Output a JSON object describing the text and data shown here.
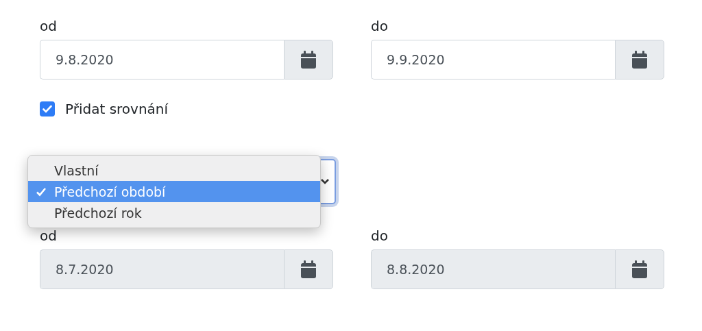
{
  "range": [
    {
      "label": "od",
      "value": "9.8.2020",
      "disabled": false
    },
    {
      "label": "do",
      "value": "9.9.2020",
      "disabled": false
    }
  ],
  "compare": {
    "label": "Přidat srovnání",
    "checked": true
  },
  "compare_select": {
    "options": [
      {
        "label": "Vlastní",
        "selected": false
      },
      {
        "label": "Předchozí období",
        "selected": true
      },
      {
        "label": "Předchozí rok",
        "selected": false
      }
    ]
  },
  "compare_range": [
    {
      "label": "od",
      "value": "8.7.2020",
      "disabled": true
    },
    {
      "label": "do",
      "value": "8.8.2020",
      "disabled": true
    }
  ]
}
